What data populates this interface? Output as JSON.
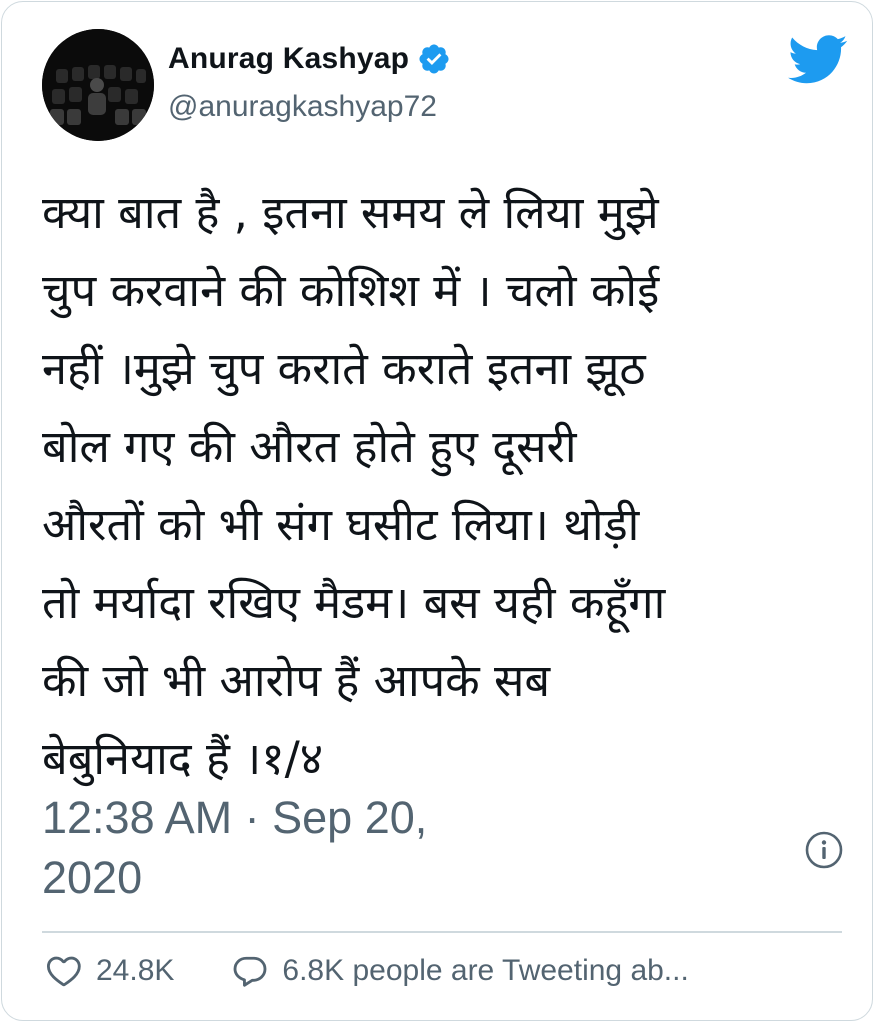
{
  "author": {
    "display_name": "Anurag Kashyap",
    "handle": "@anuragkashyap72",
    "verified": true
  },
  "tweet": {
    "lines": [
      "क्या बात है , इतना समय ले लिया मुझे",
      "चुप करवाने की कोशिश में । चलो कोई",
      "नहीं ।मुझे चुप कराते कराते इतना झूठ",
      "बोल गए की औरत होते हुए दूसरी",
      "औरतों को भी संग घसीट लिया। थोड़ी",
      "तो मर्यादा रखिए मैडम। बस यही कहूँगा",
      "की जो भी आरोप हैं आपके सब",
      "बेबुनियाद हैं ।१/४"
    ],
    "timestamp": "12:38 AM · Sep 20, 2020"
  },
  "engagement": {
    "likes": "24.8K",
    "conversation": "6.8K people are Tweeting ab..."
  },
  "icons": {
    "brand": "twitter-bird-icon",
    "verified": "verified-badge-icon",
    "info": "info-icon",
    "like": "heart-icon",
    "reply": "speech-bubble-icon"
  },
  "colors": {
    "brand_blue": "#1d9bf0",
    "text": "#0f1419",
    "secondary_text": "#536471",
    "border": "#cfd9de"
  }
}
